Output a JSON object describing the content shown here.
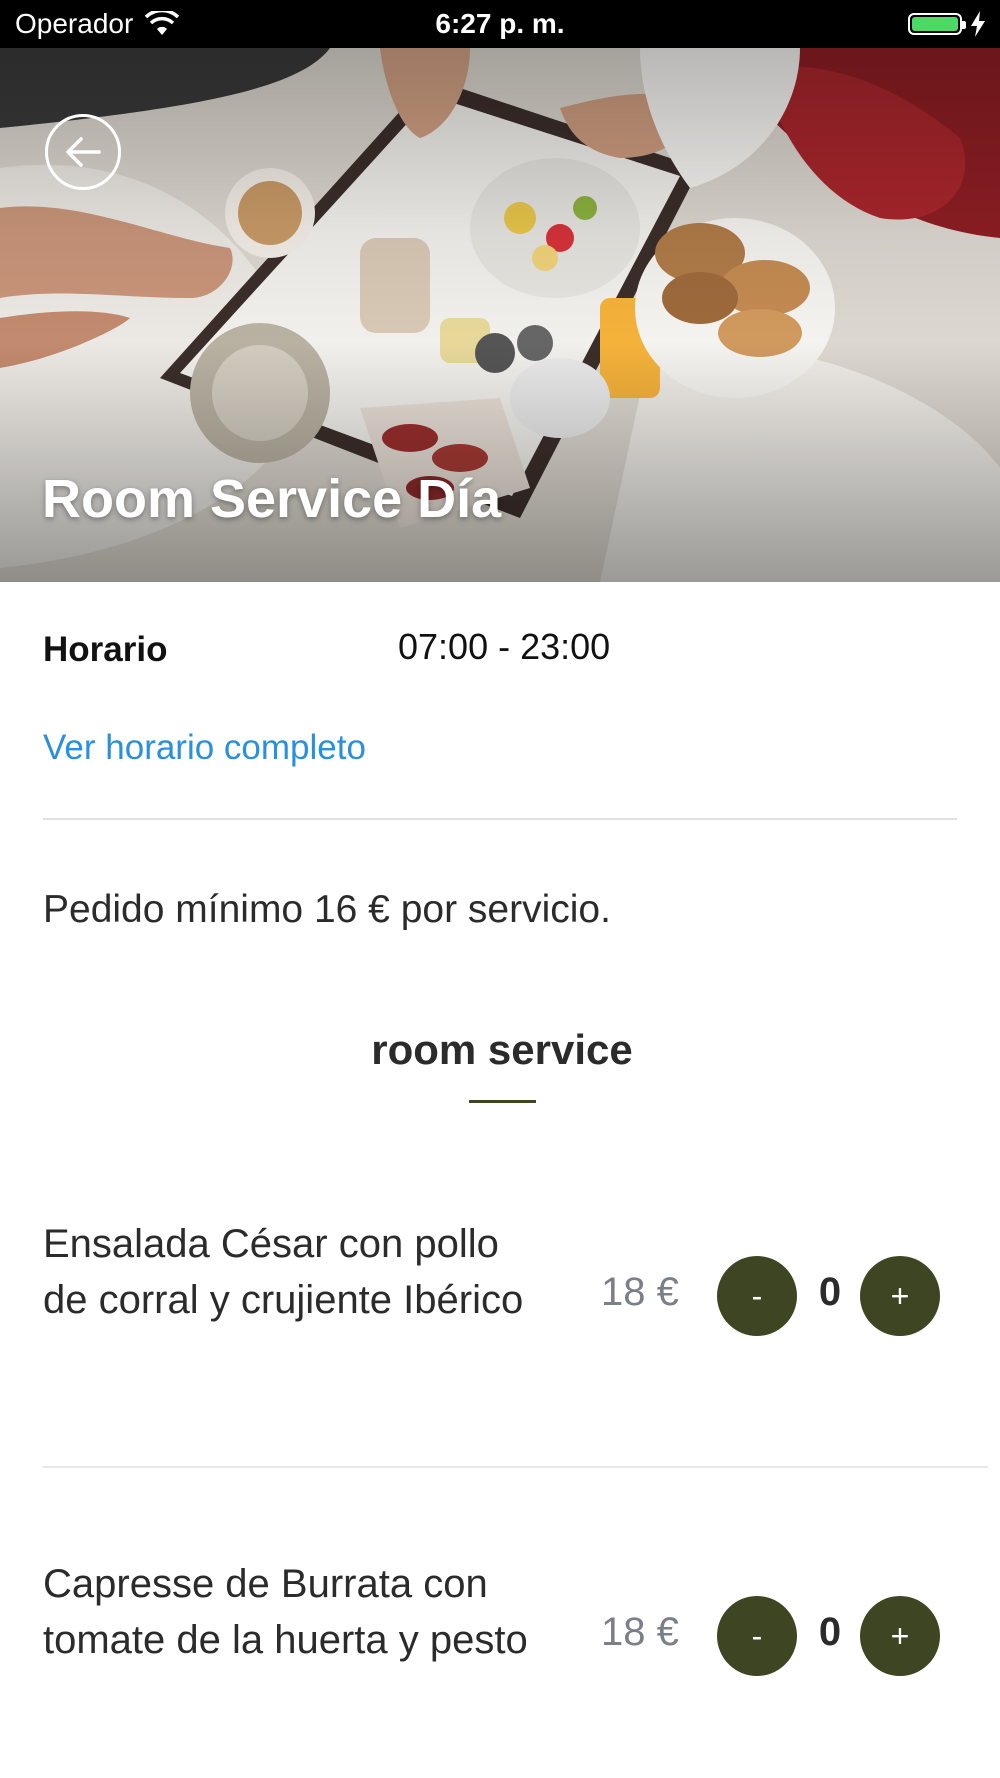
{
  "status_bar": {
    "carrier": "Operador",
    "time": "6:27 p. m.",
    "battery_color": "#4cd964"
  },
  "hero": {
    "title": "Room Service Día",
    "back_icon": "arrow-left-icon"
  },
  "schedule": {
    "label": "Horario",
    "hours": "07:00 - 23:00",
    "link": "Ver horario completo"
  },
  "notice": "Pedido mínimo 16 € por servicio.",
  "section": {
    "title": "room service"
  },
  "menu_items": [
    {
      "name": "Ensalada César con pollo de corral y crujiente Ibérico",
      "price": "18 €",
      "quantity": "0",
      "minus": "-",
      "plus": "+"
    },
    {
      "name": "Capresse de Burrata con tomate de la huerta y pesto",
      "price": "18 €",
      "quantity": "0",
      "minus": "-",
      "plus": "+"
    }
  ],
  "colors": {
    "accent": "#3e4522",
    "link": "#2a8fdc",
    "price": "#7a7f8a"
  }
}
